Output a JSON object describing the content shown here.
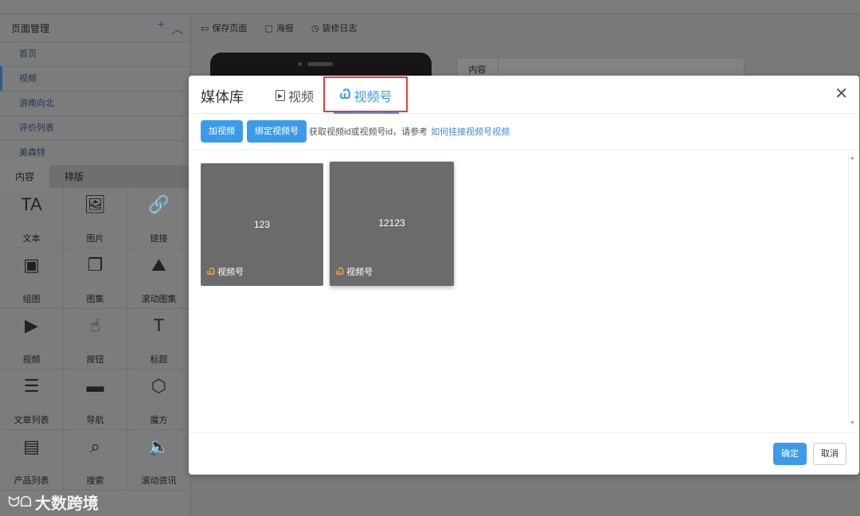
{
  "sidebar": {
    "title": "页面管理",
    "add_icon": "+",
    "collapse_icon": "︿",
    "pages": [
      "首页",
      "视频",
      "游南向北",
      "评价列表",
      "美森特"
    ],
    "tabs": [
      "内容",
      "排版"
    ],
    "components": [
      {
        "label": "文本",
        "icon": "TA"
      },
      {
        "label": "图片",
        "icon": "🖼"
      },
      {
        "label": "链接",
        "icon": "🔗"
      },
      {
        "label": "组图",
        "icon": "▣"
      },
      {
        "label": "图集",
        "icon": "❐"
      },
      {
        "label": "滚动图集",
        "icon": "⛰"
      },
      {
        "label": "视频",
        "icon": "▶"
      },
      {
        "label": "按钮",
        "icon": "☝"
      },
      {
        "label": "标题",
        "icon": "T"
      },
      {
        "label": "文章列表",
        "icon": "☰"
      },
      {
        "label": "导航",
        "icon": "▬"
      },
      {
        "label": "魔方",
        "icon": "⬡"
      },
      {
        "label": "产品列表",
        "icon": "▤"
      },
      {
        "label": "搜索",
        "icon": "⌕"
      },
      {
        "label": "滚动资讯",
        "icon": "🔈"
      }
    ]
  },
  "toolbar": {
    "save_page": "保存页面",
    "poster": "海报",
    "log": "装修日志"
  },
  "panel": {
    "tab_content": "内容"
  },
  "modal": {
    "title": "媒体库",
    "tab_video": "视频",
    "tab_channel": "视频号",
    "add_video": "加视频",
    "bind_channel": "绑定视频号",
    "hint": "获取视频id或视频号id，请参考",
    "hint_link": "如何挂接视频号视频",
    "cards": [
      {
        "name": "123",
        "tag": "视频号"
      },
      {
        "name": "12123",
        "tag": "视频号"
      }
    ],
    "confirm": "确定",
    "cancel": "取消"
  },
  "watermark": "大数跨境"
}
